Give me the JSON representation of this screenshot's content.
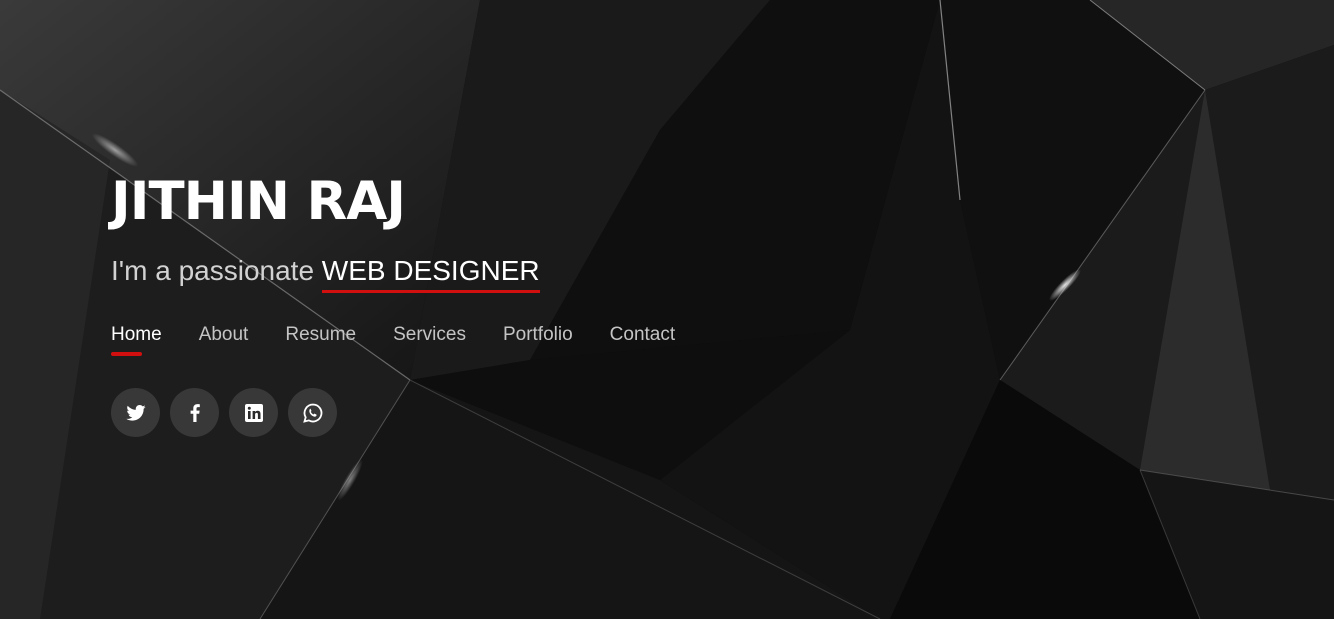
{
  "header": {
    "name": "JITHIN RAJ",
    "tagline_prefix": "I'm a passionate",
    "tagline_typed": "WEB DESIGNER"
  },
  "nav": {
    "items": [
      {
        "label": "Home",
        "active": true
      },
      {
        "label": "About"
      },
      {
        "label": "Resume"
      },
      {
        "label": "Services"
      },
      {
        "label": "Portfolio"
      },
      {
        "label": "Contact"
      }
    ]
  },
  "social": {
    "icons": [
      "twitter-icon",
      "facebook-icon",
      "linkedin-icon",
      "whatsapp-icon"
    ]
  },
  "colors": {
    "accent": "#d10f0f",
    "background": "#0b0b0b",
    "text": "#ffffff",
    "muted_text": "#c4c4c4"
  }
}
